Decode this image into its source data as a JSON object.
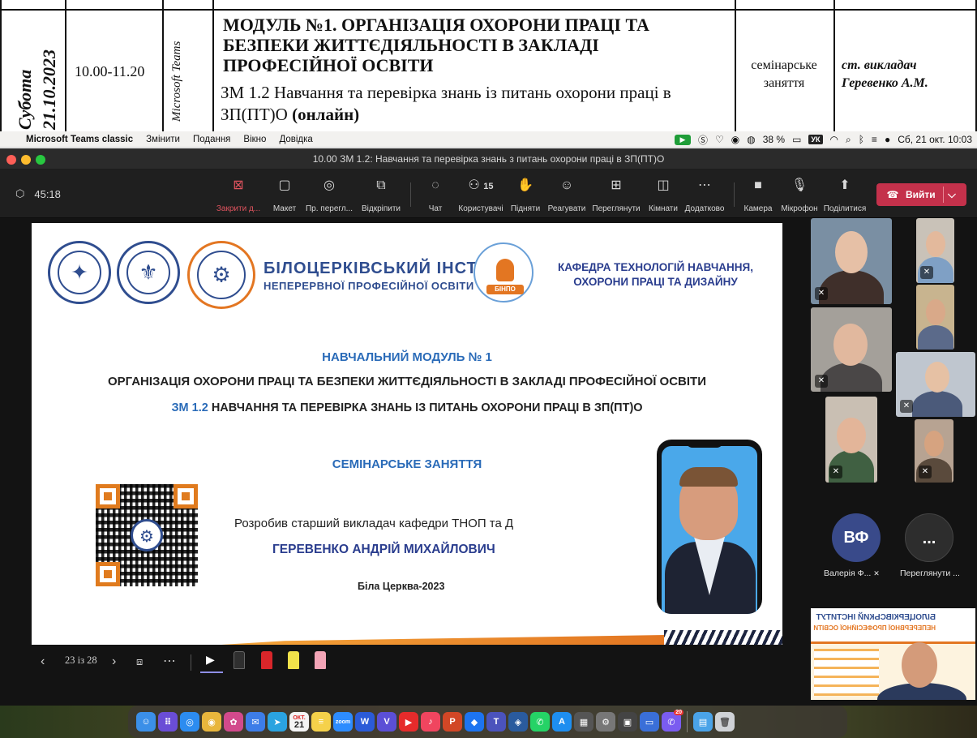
{
  "schedule": {
    "day": "Субота",
    "date": "21.10.2023",
    "time": "10.00-11.20",
    "platform": "Microsoft Teams",
    "module_title": "МОДУЛЬ №1. ОРГАНІЗАЦІЯ ОХОРОНИ ПРАЦІ ТА БЕЗПЕКИ ЖИТТЄДІЯЛЬНОСТІ В ЗАКЛАДІ ПРОФЕСІЙНОЇ ОСВІТИ",
    "submodule": "ЗМ 1.2 Навчання та перевірка знань із питань охорони праці в ЗП(ПТ)О",
    "submodule_mode": "(онлайн)",
    "session_type": "семінарське заняття",
    "teacher_title": "ст. викладач",
    "teacher_name": "Геревенко А.М."
  },
  "menubar": {
    "app": "Microsoft Teams classic",
    "items": [
      "Змінити",
      "Подання",
      "Вікно",
      "Довідка"
    ],
    "battery": "38 %",
    "keyboard": "УК",
    "datetime": "Сб, 21 окт.  10:03"
  },
  "window": {
    "title": "10.00 ЗМ 1.2: Навчання та перевірка знань з питань охорони праці в ЗП(ПТ)О",
    "timer": "45:18",
    "toolbar": [
      {
        "icon": "close-share-icon",
        "label": "Закрити д..."
      },
      {
        "icon": "layout-icon",
        "label": "Макет"
      },
      {
        "icon": "preview-icon",
        "label": "Пр. перегл..."
      },
      {
        "icon": "pop-out-icon",
        "label": "Відкріпити"
      },
      {
        "icon": "chat-icon",
        "label": "Чат"
      },
      {
        "icon": "people-icon",
        "label": "Користувачі",
        "count": "15"
      },
      {
        "icon": "raise-hand-icon",
        "label": "Підняти"
      },
      {
        "icon": "react-icon",
        "label": "Реагувати"
      },
      {
        "icon": "view-icon",
        "label": "Переглянути"
      },
      {
        "icon": "rooms-icon",
        "label": "Кімнати"
      },
      {
        "icon": "more-icon",
        "label": "Додатково"
      },
      {
        "icon": "camera-icon",
        "label": "Камера"
      },
      {
        "icon": "mic-icon",
        "label": "Мікрофон"
      },
      {
        "icon": "share-icon",
        "label": "Поділитися"
      }
    ],
    "leave_label": "Вийти"
  },
  "slide": {
    "institute_line1": "БІЛОЦЕРКІВСЬКИЙ ІНСТИТУТ",
    "institute_line2": "НЕПЕРЕРВНОЇ ПРОФЕСІЙНОЇ ОСВІТИ",
    "binpo": "БІНПО",
    "department": "КАФЕДРА ТЕХНОЛОГІЙ НАВЧАННЯ, ОХОРОНИ ПРАЦІ ТА ДИЗАЙНУ",
    "module_heading": "НАВЧАЛЬНИЙ МОДУЛЬ № 1",
    "module_title": "ОРГАНІЗАЦІЯ ОХОРОНИ ПРАЦІ ТА БЕЗПЕКИ ЖИТТЄДІЯЛЬНОСТІ В ЗАКЛАДІ ПРОФЕСІЙНОЇ ОСВІТИ",
    "zm_code": "ЗМ 1.2",
    "zm_title": "НАВЧАННЯ ТА ПЕРЕВІРКА ЗНАНЬ ІЗ ПИТАНЬ ОХОРОНИ ПРАЦІ В ЗП(ПТ)О",
    "session": "СЕМІНАРСЬКЕ ЗАНЯТТЯ",
    "author_line": "Розробив старший викладач кафедри ТНОП та Д",
    "author_name": "ГЕРЕВЕНКО АНДРІЙ МИХАЙЛОВИЧ",
    "city_year": "Біла Церква-2023"
  },
  "gallery": {
    "avatars": [
      {
        "initials": "ВФ",
        "name": "Валерія Ф...",
        "color": "#394a8a"
      },
      {
        "initials": "...",
        "name": "Переглянути ...",
        "color": "#2d2d2d"
      }
    ],
    "self_banner_1": "БІЛОЦЕРКІВСЬКИЙ ІНСТИТУТ",
    "self_banner_2": "НЕПЕРЕРВНОЇ ПРОФЕСІЙНОЇ ОСВІТИ"
  },
  "pager": {
    "page": "23 із 28"
  },
  "dock": {
    "calendar_month": "ОКТ.",
    "calendar_day": "21",
    "badge_count": "20"
  },
  "colors": {
    "slide_blue": "#2a6bb8",
    "slide_navy": "#2a3d8e",
    "accent_orange": "#e37622",
    "leave_red": "#c4314b"
  }
}
